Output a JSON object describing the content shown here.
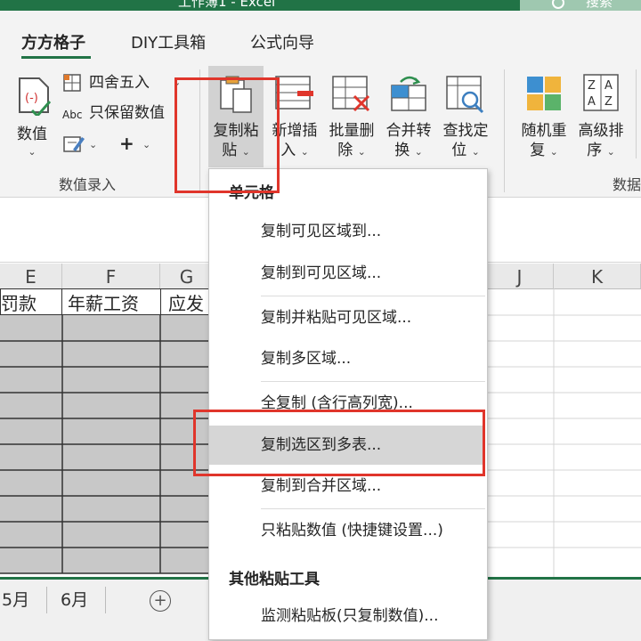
{
  "titlebar": {
    "title": "工作簿1 - Excel",
    "search_placeholder": "搜索"
  },
  "tabs": [
    {
      "label": "方方格子"
    },
    {
      "label": "DIY工具箱"
    },
    {
      "label": "公式向导"
    }
  ],
  "ribbon": {
    "value_btn": "数值",
    "round_label": "四舍五入",
    "keep_value_label": "只保留数值",
    "copy_paste_line1": "复制粘",
    "copy_paste_line2": "贴",
    "insert_line1": "新增插",
    "insert_line2": "入",
    "batch_delete_line1": "批量删",
    "batch_delete_line2": "除",
    "merge_line1": "合并转",
    "merge_line2": "换",
    "find_line1": "查找定",
    "find_line2": "位",
    "random_line1": "随机重",
    "random_line2": "复",
    "sort_line1": "高级排",
    "sort_line2": "序",
    "group_value_entry": "数值录入",
    "group_data_partial": "数据"
  },
  "sheet": {
    "columns": [
      "E",
      "F",
      "G",
      "J",
      "K"
    ],
    "header_row": [
      "罚款",
      "年薪工资",
      "应发"
    ],
    "tabs": [
      "5月",
      "6月"
    ]
  },
  "menu": {
    "section_cell": "单元格",
    "items1": [
      "复制可见区域到...",
      "复制到可见区域..."
    ],
    "items2": [
      "复制并粘贴可见区域...",
      "复制多区域..."
    ],
    "items3": [
      "全复制 (含行高列宽)...",
      "复制选区到多表...",
      "复制到合并区域..."
    ],
    "items4": [
      "只粘贴数值 (快捷键设置...)"
    ],
    "section_other": "其他粘贴工具",
    "items5": [
      "监测粘贴板(只复制数值)..."
    ]
  },
  "colors": {
    "accent_green": "#217346",
    "highlight_red": "#e0352b",
    "menu_highlight": "#d6d6d6",
    "cell_gray": "#c8c8c8"
  }
}
